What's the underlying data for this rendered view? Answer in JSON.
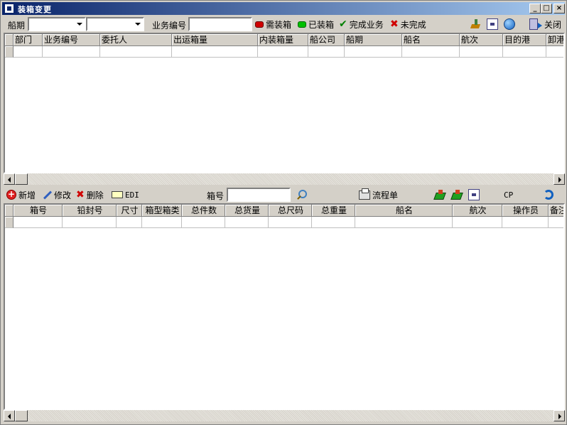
{
  "window": {
    "title": "装箱变更"
  },
  "toolbar1": {
    "ship_period_label": "船期",
    "business_no_label": "业务编号",
    "business_no_value": "",
    "need_pack": "需装箱",
    "packed": "已装箱",
    "complete": "完成业务",
    "incomplete": "未完成",
    "close": "关闭"
  },
  "grid1": {
    "columns": [
      "部门",
      "业务编号",
      "委托人",
      "出运箱量",
      "内装箱量",
      "船公司",
      "船期",
      "船名",
      "航次",
      "目的港",
      "卸港"
    ]
  },
  "toolbar2": {
    "add": "新增",
    "edit": "修改",
    "delete": "删除",
    "edi": "EDI",
    "box_no_label": "箱号",
    "box_no_value": "",
    "flow": "流程单",
    "cp": "CP"
  },
  "grid2": {
    "columns": [
      "箱号",
      "铅封号",
      "尺寸",
      "箱型箱类",
      "总件数",
      "总货量",
      "总尺码",
      "总重量",
      "船名",
      "航次",
      "操作员",
      "备注"
    ]
  },
  "colors": {
    "title_start": "#0a246a",
    "title_end": "#a6caf0",
    "face": "#d4d0c8"
  }
}
